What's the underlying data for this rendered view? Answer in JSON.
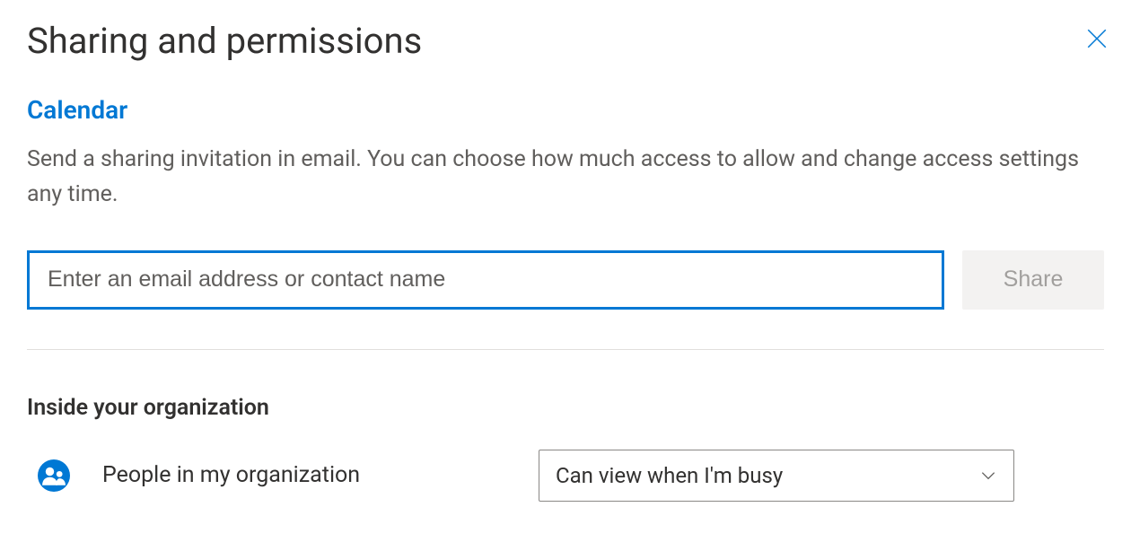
{
  "header": {
    "title": "Sharing and permissions"
  },
  "calendar": {
    "subtitle": "Calendar",
    "description": "Send a sharing invitation in email. You can choose how much access to allow and change access settings any time."
  },
  "invite": {
    "placeholder": "Enter an email address or contact name",
    "value": "",
    "share_label": "Share"
  },
  "org": {
    "section_heading": "Inside your organization",
    "row_label": "People in my organization",
    "permission_selected": "Can view when I'm busy"
  }
}
